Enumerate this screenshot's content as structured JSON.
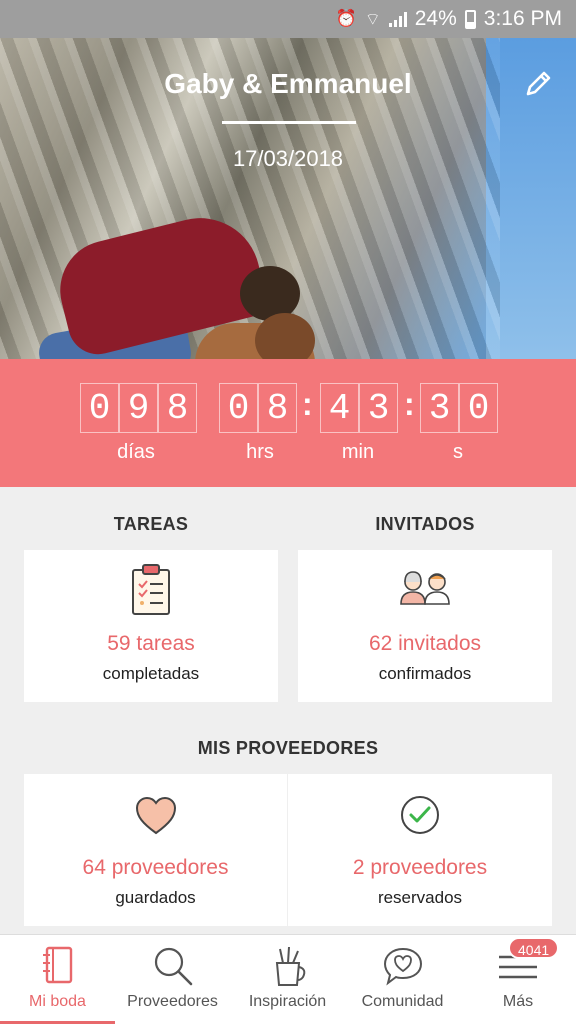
{
  "status_bar": {
    "battery": "24%",
    "time": "3:16 PM"
  },
  "hero": {
    "couple_names": "Gaby & Emmanuel",
    "wedding_date": "17/03/2018"
  },
  "countdown": {
    "days": [
      "0",
      "9",
      "8"
    ],
    "hours": [
      "0",
      "8"
    ],
    "minutes": [
      "4",
      "3"
    ],
    "seconds": [
      "3",
      "0"
    ],
    "labels": {
      "days": "días",
      "hours": "hrs",
      "minutes": "min",
      "seconds": "s"
    }
  },
  "tasks": {
    "title": "TAREAS",
    "count": "59 tareas",
    "subtitle": "completadas"
  },
  "guests": {
    "title": "INVITADOS",
    "count": "62 invitados",
    "subtitle": "confirmados"
  },
  "vendors": {
    "title": "MIS PROVEEDORES",
    "saved": {
      "count": "64 proveedores",
      "subtitle": "guardados"
    },
    "booked": {
      "count": "2 proveedores",
      "subtitle": "reservados"
    }
  },
  "bottom_nav": {
    "items": [
      {
        "label": "Mi boda",
        "icon": "notebook-icon"
      },
      {
        "label": "Proveedores",
        "icon": "search-icon"
      },
      {
        "label": "Inspiración",
        "icon": "pencil-cup-icon"
      },
      {
        "label": "Comunidad",
        "icon": "chat-heart-icon"
      },
      {
        "label": "Más",
        "icon": "menu-icon"
      }
    ],
    "badge": "4041",
    "active_index": 0
  },
  "colors": {
    "accent": "#f3777a",
    "accent_text": "#e8686b"
  }
}
